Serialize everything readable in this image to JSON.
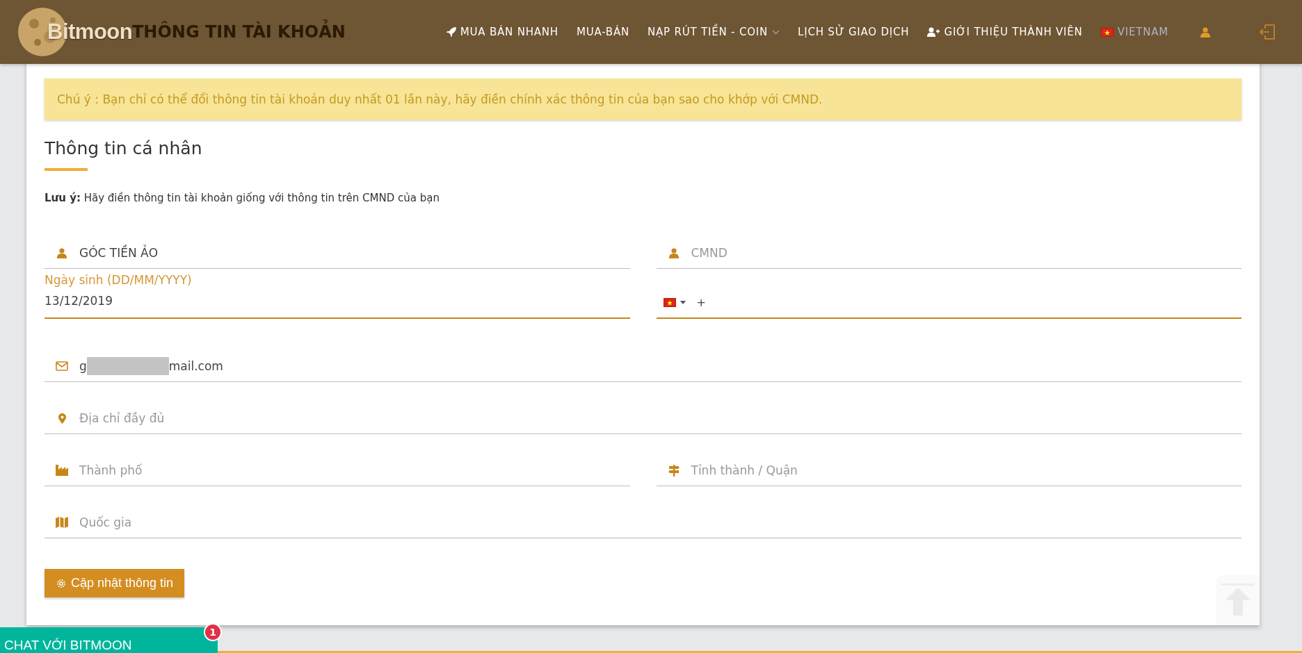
{
  "header": {
    "logo": "Bitmoon",
    "page_title": "THÔNG TIN TÀI KHOẢN",
    "nav": [
      {
        "label": "MUA BÁN NHANH",
        "kind": "link",
        "dropdown": false
      },
      {
        "label": "MUA-BÁN",
        "kind": "link",
        "dropdown": false
      },
      {
        "label": "NẠP RÚT TIỀN - COIN",
        "kind": "link",
        "dropdown": true
      },
      {
        "label": "LỊCH SỬ GIAO DỊCH",
        "kind": "link",
        "dropdown": false
      },
      {
        "label": "GIỚI THIỆU THÀNH VIÊN",
        "kind": "link",
        "dropdown": false
      },
      {
        "label": "VIETNAM",
        "kind": "language",
        "dropdown": false
      }
    ]
  },
  "alert": "Chú ý : Bạn chỉ có thể đổi thông tin tài khoản duy nhất 01 lần này, hãy điền chính xác thông tin của bạn sao cho khớp với CMND.",
  "section": {
    "title": "Thông tin cá nhân",
    "note": "**Lưu ý:** Hãy điền thông tin tài khoản giống với thông tin trên CMND của bạn"
  },
  "fields": [
    {
      "kind": "person",
      "value": "GÓC TIỀN ẢO",
      "focused": false
    },
    {
      "kind": "idcard",
      "placeholder": "CMND",
      "focused": false
    },
    {
      "kind": "date",
      "label": "Ngày sinh (DD/MM/YYYY)",
      "value": "13/12/2019",
      "focused": true
    },
    {
      "kind": "phone",
      "prefix": "+",
      "focused": true
    },
    {
      "kind": "email",
      "value_start": "g",
      "value_end": "mail.com",
      "focused": false
    },
    {
      "kind": "address",
      "placeholder": "Địa chỉ đầy đủ",
      "focused": false
    },
    {
      "kind": "city",
      "placeholder": "Thành phố",
      "focused": false
    },
    {
      "kind": "district",
      "placeholder": "Tỉnh thành / Quận",
      "focused": false
    },
    {
      "kind": "country",
      "placeholder": "Quốc gia",
      "focused": false
    }
  ],
  "submit": "Cập nhật thông tin",
  "chat": {
    "label": "CHAT VỚI BITMOON",
    "badge": "1"
  }
}
